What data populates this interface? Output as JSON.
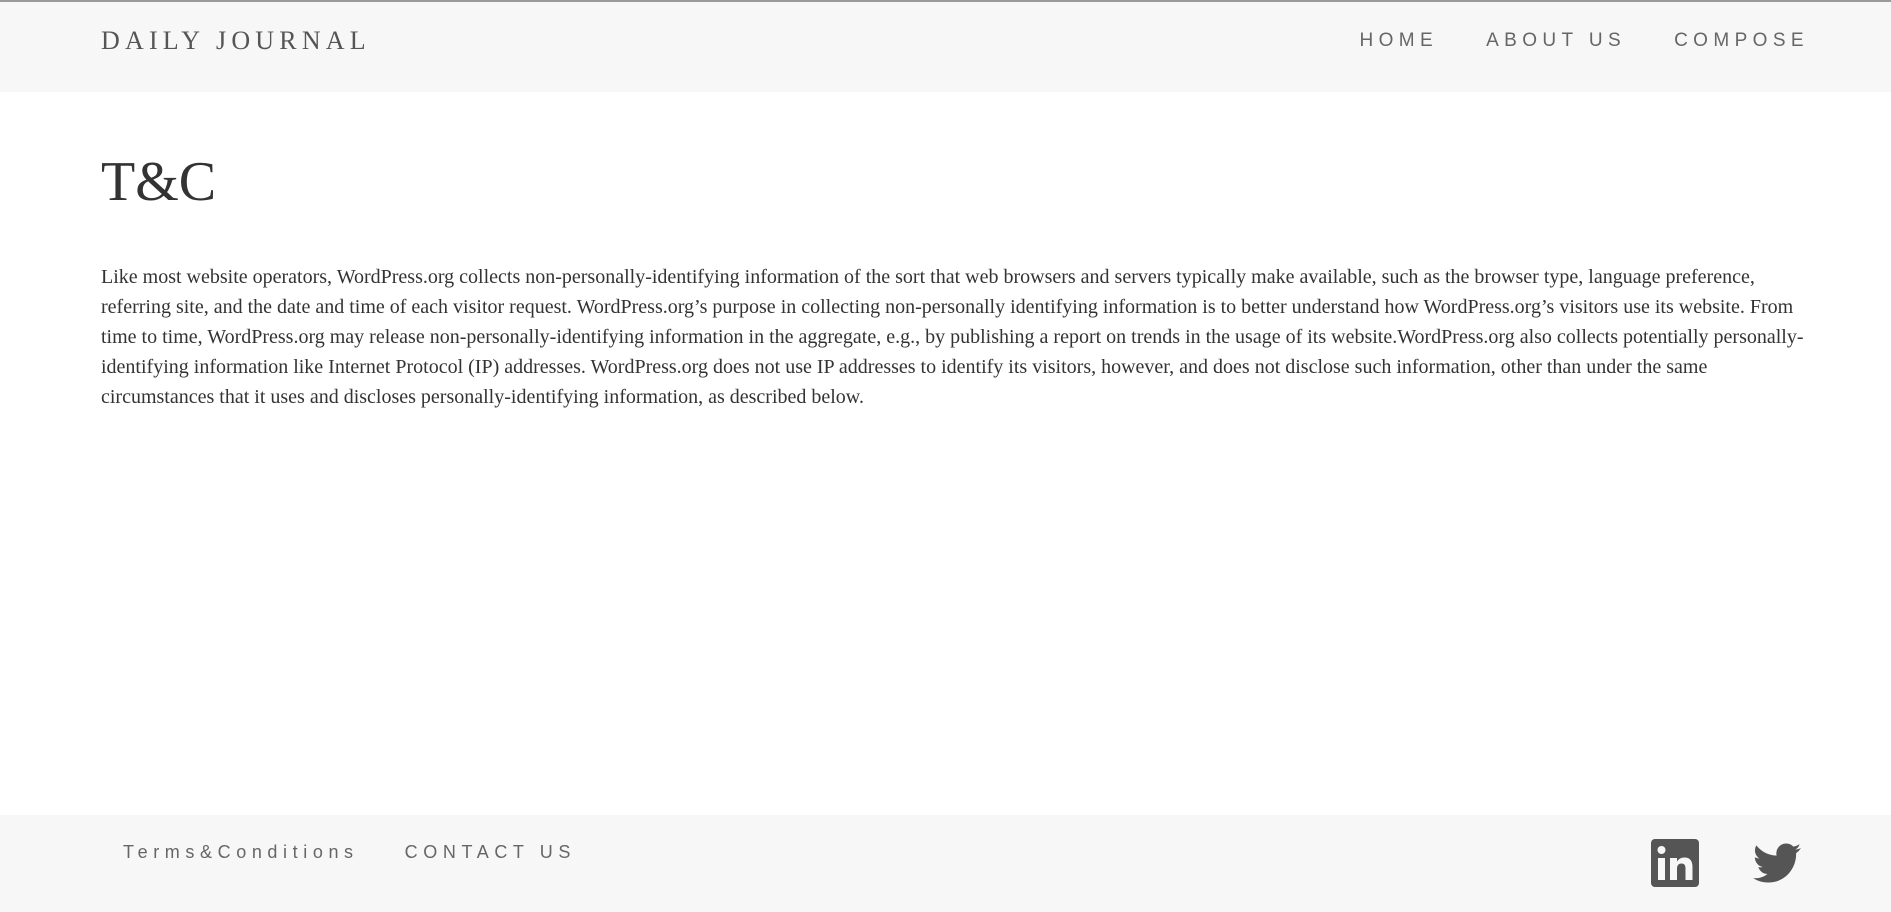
{
  "navbar": {
    "brand": "DAILY JOURNAL",
    "links": [
      {
        "label": "HOME"
      },
      {
        "label": "ABOUT US"
      },
      {
        "label": "COMPOSE"
      }
    ]
  },
  "main": {
    "title": "T&C",
    "paragraph": "Like most website operators, WordPress.org collects non-personally-identifying information of the sort that web browsers and servers typically make available, such as the browser type, language preference, referring site, and the date and time of each visitor request. WordPress.org’s purpose in collecting non-personally identifying information is to better understand how WordPress.org’s visitors use its website. From time to time, WordPress.org may release non-personally-identifying information in the aggregate, e.g., by publishing a report on trends in the usage of its website.WordPress.org also collects potentially personally-identifying information like Internet Protocol (IP) addresses. WordPress.org does not use IP addresses to identify its visitors, however, and does not disclose such information, other than under the same circumstances that it uses and discloses personally-identifying information, as described below."
  },
  "footer": {
    "links": [
      {
        "label": "Terms&Conditions"
      },
      {
        "label": "CONTACT US"
      }
    ],
    "social_icons": [
      "linkedin-icon",
      "twitter-icon"
    ],
    "icon_color": "#555555",
    "background": "#f7f7f7"
  }
}
